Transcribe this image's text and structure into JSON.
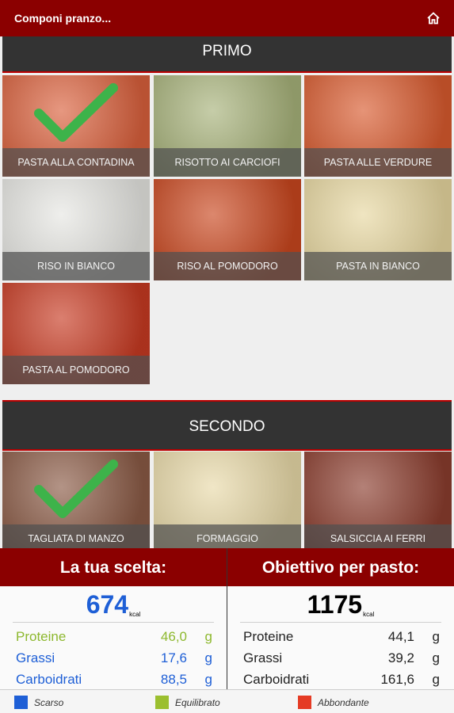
{
  "header": {
    "title": "Componi pranzo...",
    "home_icon": "home-icon"
  },
  "primo": {
    "title": "PRIMO",
    "items": [
      {
        "label": "PASTA ALLA CONTADINA",
        "selected": true,
        "color": "#d9603c"
      },
      {
        "label": "RISOTTO AI CARCIOFI",
        "selected": false,
        "color": "#a7b27a"
      },
      {
        "label": "PASTA ALLE VERDURE",
        "selected": false,
        "color": "#d85a2e"
      },
      {
        "label": "RISO IN BIANCO",
        "selected": false,
        "color": "#e6e6e2"
      },
      {
        "label": "RISO AL POMODORO",
        "selected": false,
        "color": "#c9471f"
      },
      {
        "label": "PASTA IN BIANCO",
        "selected": false,
        "color": "#e7d7a0"
      },
      {
        "label": "PASTA AL POMODORO",
        "selected": false,
        "color": "#c73a22"
      }
    ]
  },
  "secondo": {
    "title": "SECONDO",
    "items": [
      {
        "label": "TAGLIATA DI MANZO",
        "selected": true,
        "color": "#8a5a45"
      },
      {
        "label": "FORMAGGIO",
        "selected": false,
        "color": "#e8d9a8"
      },
      {
        "label": "SALSICCIA AI FERRI",
        "selected": false,
        "color": "#8b3d2e"
      }
    ]
  },
  "scelta": {
    "title": "La tua scelta:",
    "kcal": "674",
    "unit": "kcal",
    "rows": [
      {
        "label": "Proteine",
        "value": "46,0",
        "unit": "g",
        "color": "#8db82e"
      },
      {
        "label": "Grassi",
        "value": "17,6",
        "unit": "g",
        "color": "#1e5fd6"
      },
      {
        "label": "Carboidrati",
        "value": "88,5",
        "unit": "g",
        "color": "#1e5fd6"
      }
    ]
  },
  "obiettivo": {
    "title": "Obiettivo per pasto:",
    "kcal": "1175",
    "unit": "kcal",
    "rows": [
      {
        "label": "Proteine",
        "value": "44,1",
        "unit": "g"
      },
      {
        "label": "Grassi",
        "value": "39,2",
        "unit": "g"
      },
      {
        "label": "Carboidrati",
        "value": "161,6",
        "unit": "g"
      }
    ]
  },
  "legend": [
    {
      "label": "Scarso",
      "color": "#1e5fd6"
    },
    {
      "label": "Equilibrato",
      "color": "#9bbf2f"
    },
    {
      "label": "Abbondante",
      "color": "#e53b24"
    }
  ],
  "colors": {
    "kcal_blue": "#1e5fd6",
    "check_green": "#3db34a",
    "brand_red": "#8b0000"
  }
}
